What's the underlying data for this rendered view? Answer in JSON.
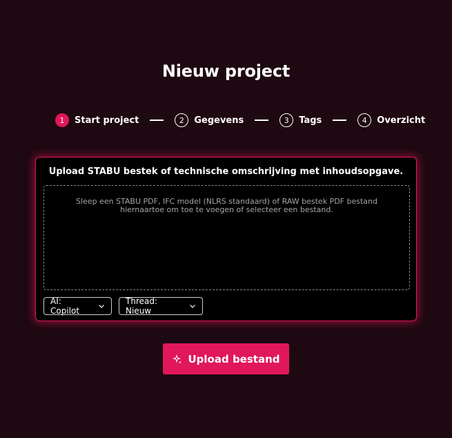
{
  "page": {
    "title": "Nieuw project"
  },
  "stepper": {
    "steps": [
      {
        "number": "1",
        "label": "Start project",
        "active": true
      },
      {
        "number": "2",
        "label": "Gegevens",
        "active": false
      },
      {
        "number": "3",
        "label": "Tags",
        "active": false
      },
      {
        "number": "4",
        "label": "Overzicht",
        "active": false
      }
    ]
  },
  "upload_card": {
    "heading": "Upload STABU bestek of technische omschrijving met inhoudsopgave.",
    "dropzone_text_line1": "Sleep een STABU PDF, IFC model (NLRS standaard) of RAW bestek PDF bestand",
    "dropzone_text_line2": "hiernaartoe om toe te voegen of selecteer een bestand.",
    "ai_select": {
      "value": "AI: Copilot",
      "icon": "chevron-down-icon"
    },
    "thread_select": {
      "value": "Thread: Nieuw",
      "icon": "chevron-down-icon"
    }
  },
  "upload_button": {
    "label": "Upload bestand",
    "icon": "sparkle-icon"
  },
  "colors": {
    "background": "#1e0811",
    "accent": "#e0175a",
    "card": "#000000",
    "muted_text": "#a6a6a6"
  }
}
